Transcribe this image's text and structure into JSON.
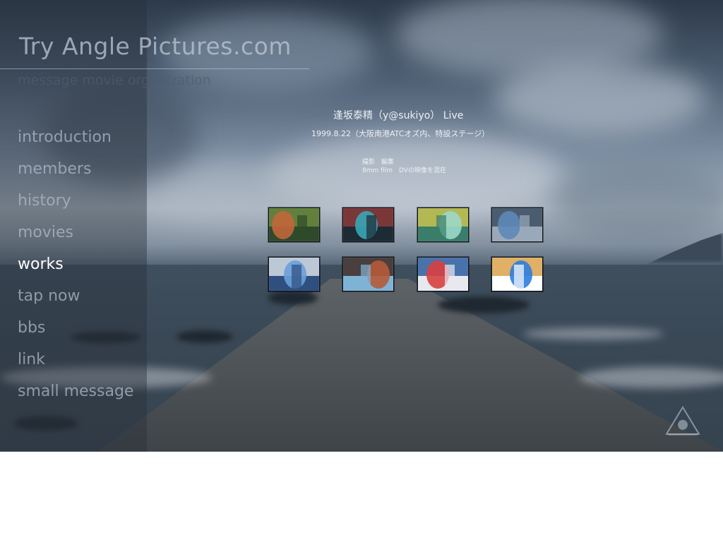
{
  "site": {
    "title": "Try Angle Pictures.com",
    "subtitle": "message movie organization"
  },
  "nav": {
    "items": [
      {
        "label": "introduction",
        "active": false
      },
      {
        "label": "members",
        "active": false
      },
      {
        "label": "history",
        "active": false
      },
      {
        "label": "movies",
        "active": false
      },
      {
        "label": "works",
        "active": true
      },
      {
        "label": "tap now",
        "active": false
      },
      {
        "label": "bbs",
        "active": false
      },
      {
        "label": "link",
        "active": false
      },
      {
        "label": "small message",
        "active": false
      }
    ]
  },
  "work": {
    "title": "逢坂泰精（y@sukiyo） Live",
    "date": "1999.8.22（大阪南港ATCオズ内、特設ステージ）",
    "credit_line1": "撮影　編集",
    "credit_line2": "8mm film　DVの映像を混在"
  },
  "thumbnails": [
    {
      "name": "thumb-guitar-closeup",
      "palette": [
        "#c2663a",
        "#6b8a3e",
        "#2e4a2a"
      ]
    },
    {
      "name": "thumb-stage-wide",
      "palette": [
        "#3aa6b5",
        "#8c3a3a",
        "#1d2b34"
      ]
    },
    {
      "name": "thumb-singer-green",
      "palette": [
        "#9bd8c8",
        "#c9c24e",
        "#3a7d6a"
      ]
    },
    {
      "name": "thumb-microphone",
      "palette": [
        "#5d88b8",
        "#3e4f63",
        "#9aa9ba"
      ]
    },
    {
      "name": "thumb-building",
      "palette": [
        "#6aa0d9",
        "#d6dde6",
        "#2e4f80"
      ]
    },
    {
      "name": "thumb-band",
      "palette": [
        "#b55b38",
        "#3f2a24",
        "#7fb3d6"
      ]
    },
    {
      "name": "thumb-singer-red",
      "palette": [
        "#d84040",
        "#2b5d9e",
        "#e8e8f0"
      ]
    },
    {
      "name": "thumb-puppet",
      "palette": [
        "#2f7de0",
        "#d9a24a",
        "#ffffff"
      ]
    }
  ],
  "colors": {
    "nav_inactive": "#afbac8",
    "nav_active": "#ffffff",
    "content_text": "#eef1f4"
  }
}
